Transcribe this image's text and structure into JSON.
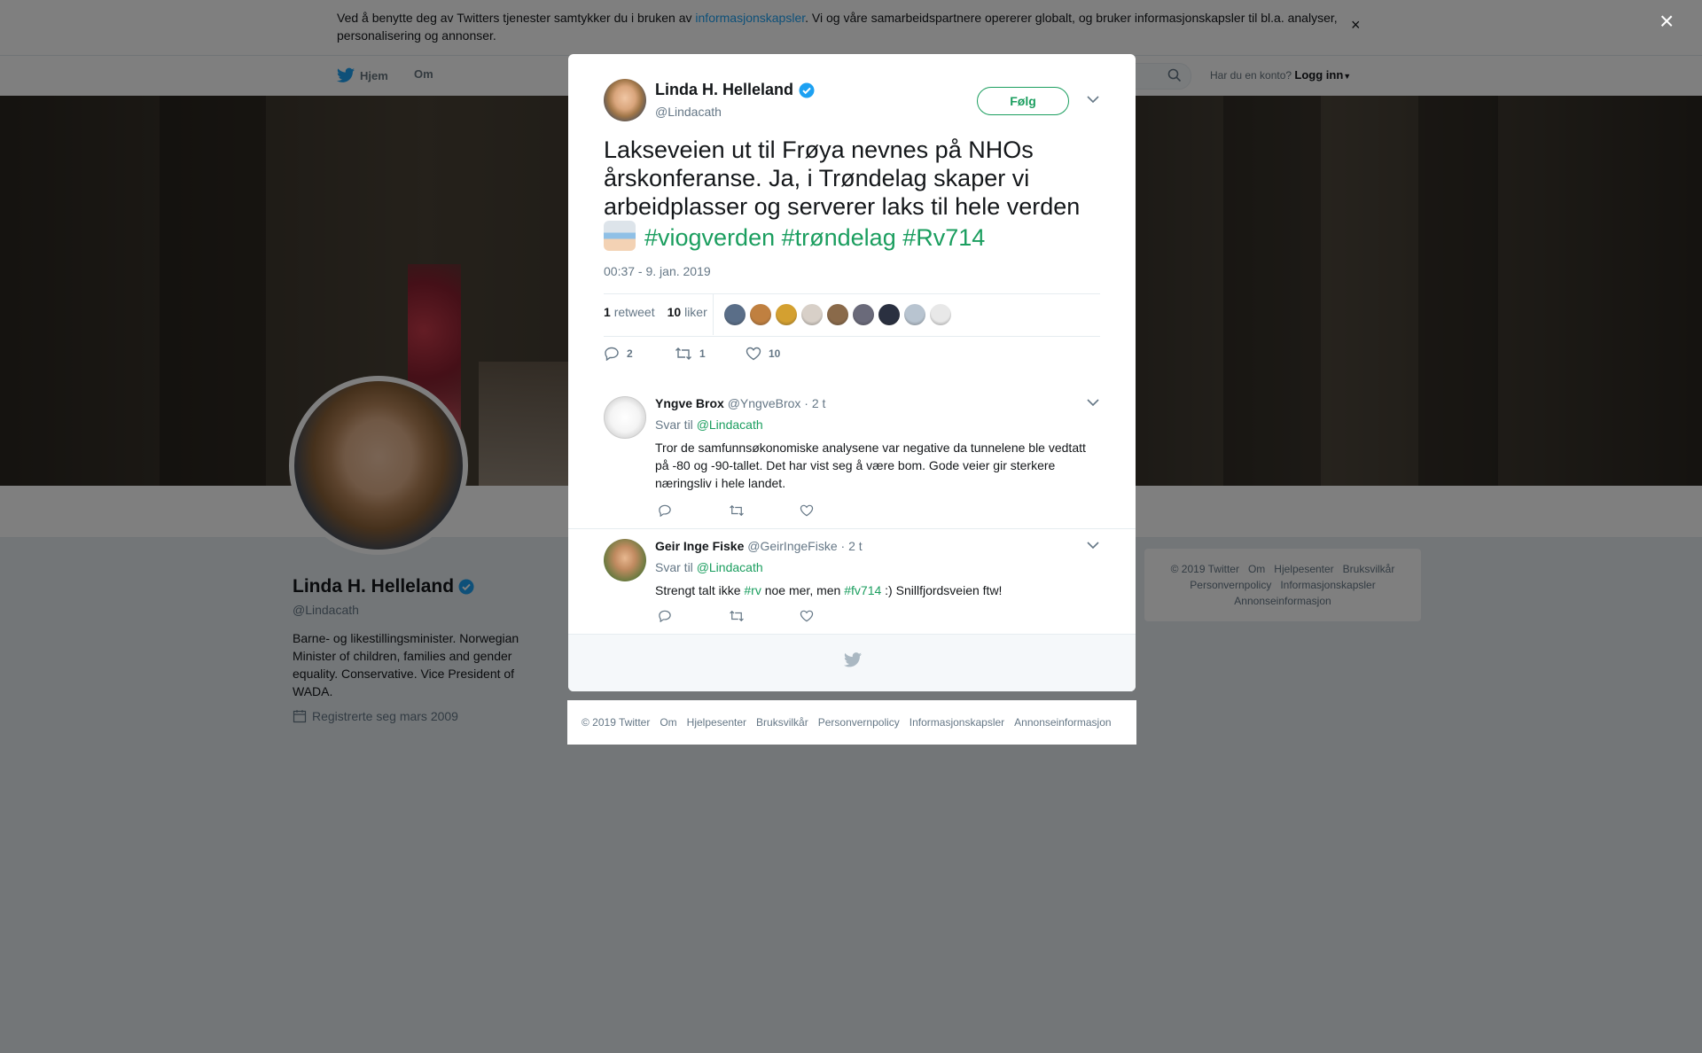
{
  "cookie": {
    "text_before": "Ved å benytte deg av Twitters tjenester samtykker du i bruken av ",
    "link": "informasjonskapsler",
    "text_after": ". Vi og våre samarbeidspartnere opererer globalt, og bruker informasjonskapsler til bl.a. analyser, personalisering og annonser.",
    "close": "×"
  },
  "nav": {
    "home": "Hjem",
    "about": "Om",
    "account_prompt": "Har du en konto?",
    "login": "Logg inn"
  },
  "profile": {
    "name": "Linda H. Helleland",
    "handle": "@Lindacath",
    "bio": "Barne- og likestillingsminister. Norwegian Minister of children, families and gender equality. Conservative. Vice President of WADA.",
    "joined": "Registrerte seg mars 2009"
  },
  "right_footer": {
    "items": [
      "© 2019 Twitter",
      "Om",
      "Hjelpesenter",
      "Bruksvilkår",
      "Personvernpolicy",
      "Informasjonskapsler",
      "Annonseinformasjon"
    ]
  },
  "overlay": {
    "close": "×"
  },
  "tweet": {
    "name": "Linda H. Helleland",
    "handle": "@Lindacath",
    "follow": "Følg",
    "text": "Lakseveien ut til Frøya nevnes på NHOs årskonferanse. Ja, i Trøndelag skaper vi arbeidplasser og serverer laks til hele verden",
    "hashtags": [
      "#viogverden",
      "#trøndelag",
      "#Rv714"
    ],
    "time": "00:37 - 9. jan. 2019",
    "retweets_count": "1",
    "retweets_label": "retweet",
    "likes_count": "10",
    "likes_label": "liker",
    "liker_colors": [
      "#5a6e88",
      "#c08040",
      "#d4a030",
      "#d8d0c8",
      "#8a6a4a",
      "#6a6a7a",
      "#2a3040",
      "#b8c4d0",
      "#e8e8e8"
    ],
    "reply_count": "2",
    "retweet_action_count": "1",
    "like_action_count": "10"
  },
  "replies": [
    {
      "name": "Yngve Brox",
      "handle": "@YngveBrox",
      "time": "· 2 t",
      "reply_to_label": "Svar til",
      "reply_to": "@Lindacath",
      "text": "Tror de samfunnsøkonomiske analysene var negative da tunnelene ble vedtatt på -80 og -90-tallet. Det har vist seg å være bom. Gode veier gir sterkere næringsliv i hele landet."
    },
    {
      "name": "Geir Inge Fiske",
      "handle": "@GeirIngeFiske",
      "time": "· 2 t",
      "reply_to_label": "Svar til",
      "reply_to": "@Lindacath",
      "text_a": "Strengt talt ikke ",
      "tag_a": "#rv",
      "text_b": " noe mer, men ",
      "tag_b": "#fv714",
      "text_c": " :) Snillfjordsveien ftw!"
    }
  ],
  "bottom_footer": {
    "items": [
      "© 2019 Twitter",
      "Om",
      "Hjelpesenter",
      "Bruksvilkår",
      "Personvernpolicy",
      "Informasjonskapsler",
      "Annonseinformasjon"
    ]
  },
  "colors": {
    "accent": "#1b9e5f",
    "twitter_blue": "#1da1f2",
    "verified": "#1da1f2"
  }
}
